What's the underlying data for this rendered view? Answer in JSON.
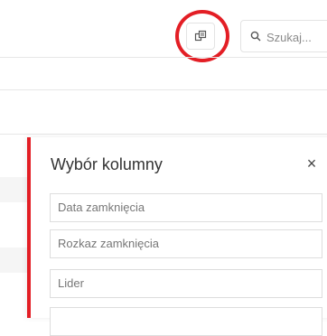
{
  "toolbar": {
    "column_chooser_icon": "column-chooser-icon",
    "search": {
      "placeholder": "Szukaj...",
      "icon": "search-icon"
    }
  },
  "panel": {
    "title": "Wybór kolumny",
    "close_label": "×",
    "items": [
      {
        "label": "Data zamknięcia"
      },
      {
        "label": "Rozkaz zamknięcia"
      },
      {
        "label": "Lider"
      },
      {
        "label": ""
      }
    ]
  },
  "colors": {
    "accent": "#e31e25",
    "border": "#dddddd"
  }
}
